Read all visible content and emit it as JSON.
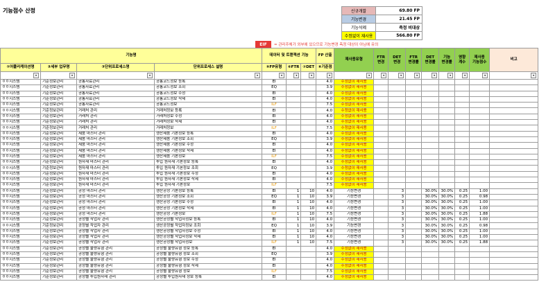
{
  "title": "기능점수 산정",
  "summary": [
    {
      "label": "신규개발",
      "value": "69.80 FP",
      "bg": "#e6b8b7"
    },
    {
      "label": "기능변경",
      "value": "21.45 FP",
      "bg": "#b8cce4"
    },
    {
      "label": "기능삭제",
      "value": "측정 비대상",
      "bg": "#ffffff"
    },
    {
      "label": "수정없이 재사용",
      "value": "566.80 FP",
      "bg": "#ffff00"
    }
  ],
  "eif": {
    "badge": "EIF",
    "note": "= 관리주체가 외부에 있으므로 기능변경 측정 대상이 아님에 유의"
  },
  "headers": {
    "group_function": "기능명",
    "group_data": "데이터 및 트랜잭션 기능",
    "group_fp": "FP 산출",
    "reuse_type": "재사용유형",
    "ftr_change": "FTR\n변경",
    "det_change": "DET\n변경",
    "ftr_rate": "FTR\n변경률",
    "det_rate": "DET\n변경률",
    "func_rate": "기능\n변경률",
    "impact": "영향\n계수",
    "reuse_fp": "재사용\n기능점수",
    "remark": "비고",
    "app": "①어플리케이션명",
    "biz": "②세부 업무명",
    "unit": "③단위프로세스명",
    "desc": "단위프로세스 설명",
    "fp_type": "⑤FP유형",
    "ftr": "⑥FTR",
    "det": "⑦DET",
    "base": "⑧기준점"
  },
  "rows": [
    [
      "ㅇㅇ시스템",
      "기준정보관리",
      "공통자료관리",
      "공통코드정보 등록",
      "EI",
      "",
      "",
      "4.0",
      "수정없이 재사용",
      "",
      "",
      "",
      "",
      "",
      "",
      "",
      ""
    ],
    [
      "ㅇㅇ시스템",
      "기준정보관리",
      "공통자료관리",
      "공통코드정보 조회",
      "EQ",
      "",
      "",
      "3.9",
      "수정없이 재사용",
      "",
      "",
      "",
      "",
      "",
      "",
      "",
      ""
    ],
    [
      "ㅇㅇ시스템",
      "기준정보관리",
      "공통자료관리",
      "공통코드정보 수정",
      "EI",
      "",
      "",
      "4.0",
      "수정없이 재사용",
      "",
      "",
      "",
      "",
      "",
      "",
      "",
      ""
    ],
    [
      "ㅇㅇ시스템",
      "기준정보관리",
      "공통자료관리",
      "공통코드정보 삭제",
      "EI",
      "",
      "",
      "4.0",
      "수정없이 재사용",
      "",
      "",
      "",
      "",
      "",
      "",
      "",
      ""
    ],
    [
      "ㅇㅇ시스템",
      "기준정보관리",
      "공통자료관리",
      "공통코드정보",
      "ILF",
      "",
      "",
      "7.5",
      "수정없이 재사용",
      "",
      "",
      "",
      "",
      "",
      "",
      "",
      ""
    ],
    [
      "ㅇㅇ시스템",
      "기준정보관리",
      "거래처 관리",
      "거래처정보 등록",
      "EI",
      "",
      "",
      "4.0",
      "수정없이 재사용",
      "",
      "",
      "",
      "",
      "",
      "",
      "",
      ""
    ],
    [
      "ㅇㅇ시스템",
      "기준정보관리",
      "거래처 관리",
      "거래처정보 수정",
      "EI",
      "",
      "",
      "4.0",
      "수정없이 재사용",
      "",
      "",
      "",
      "",
      "",
      "",
      "",
      ""
    ],
    [
      "ㅇㅇ시스템",
      "기준정보관리",
      "거래처 관리",
      "거래처정보 삭제",
      "EI",
      "",
      "",
      "4.0",
      "수정없이 재사용",
      "",
      "",
      "",
      "",
      "",
      "",
      "",
      ""
    ],
    [
      "ㅇㅇ시스템",
      "기준정보관리",
      "거래처 관리",
      "거래처정보",
      "ILF",
      "",
      "",
      "7.5",
      "수정없이 재사용",
      "",
      "",
      "",
      "",
      "",
      "",
      "",
      ""
    ],
    [
      "ㅇㅇ시스템",
      "기준정보관리",
      "제품 마스터 관리",
      "생산제품 기본정보 등록",
      "EI",
      "",
      "",
      "4.0",
      "수정없이 재사용",
      "",
      "",
      "",
      "",
      "",
      "",
      "",
      ""
    ],
    [
      "ㅇㅇ시스템",
      "기준정보관리",
      "제품 마스터 관리",
      "생산제품 기본정보 조회",
      "EQ",
      "",
      "",
      "3.9",
      "수정없이 재사용",
      "",
      "",
      "",
      "",
      "",
      "",
      "",
      ""
    ],
    [
      "ㅇㅇ시스템",
      "기준정보관리",
      "제품 마스터 관리",
      "생산제품 기본정보 수정",
      "EI",
      "",
      "",
      "4.0",
      "수정없이 재사용",
      "",
      "",
      "",
      "",
      "",
      "",
      "",
      ""
    ],
    [
      "ㅇㅇ시스템",
      "기준정보관리",
      "제품 마스터 관리",
      "생산제품 기본정보 삭제",
      "EI",
      "",
      "",
      "4.0",
      "수정없이 재사용",
      "",
      "",
      "",
      "",
      "",
      "",
      "",
      ""
    ],
    [
      "ㅇㅇ시스템",
      "기준정보관리",
      "제품 마스터 관리",
      "생산제품 기본정보",
      "ILF",
      "",
      "",
      "7.5",
      "수정없이 재사용",
      "",
      "",
      "",
      "",
      "",
      "",
      "",
      ""
    ],
    [
      "ㅇㅇ시스템",
      "기준정보관리",
      "원자재 마스터 관리",
      "투입 원자재 기본정보 등록",
      "EI",
      "",
      "",
      "4.0",
      "수정없이 재사용",
      "",
      "",
      "",
      "",
      "",
      "",
      "",
      ""
    ],
    [
      "ㅇㅇ시스템",
      "기준정보관리",
      "원자재 마스터 관리",
      "투입 원자재 기본정보 조회",
      "EQ",
      "",
      "",
      "3.9",
      "수정없이 재사용",
      "",
      "",
      "",
      "",
      "",
      "",
      "",
      ""
    ],
    [
      "ㅇㅇ시스템",
      "기준정보관리",
      "원자재 마스터 관리",
      "투입 원자재 기본정보 수정",
      "EI",
      "",
      "",
      "4.0",
      "수정없이 재사용",
      "",
      "",
      "",
      "",
      "",
      "",
      "",
      ""
    ],
    [
      "ㅇㅇ시스템",
      "기준정보관리",
      "원자재 마스터 관리",
      "투입 원자재 기본정보 삭제",
      "EI",
      "",
      "",
      "4.0",
      "수정없이 재사용",
      "",
      "",
      "",
      "",
      "",
      "",
      "",
      ""
    ],
    [
      "ㅇㅇ시스템",
      "기준정보관리",
      "원자재 마스터 관리",
      "투입 원자재 기본정보",
      "ILF",
      "",
      "",
      "7.5",
      "수정없이 재사용",
      "",
      "",
      "",
      "",
      "",
      "",
      "",
      ""
    ],
    [
      "ㅇㅇ시스템",
      "기준정보관리",
      "공정 마스터 관리",
      "생산공정 기본정보 등록",
      "EI",
      "1",
      "10",
      "4.0",
      "기능변경",
      "",
      "3",
      "",
      "30.0%",
      "30.0%",
      "0.25",
      "1.00",
      ""
    ],
    [
      "ㅇㅇ시스템",
      "기준정보관리",
      "공정 마스터 관리",
      "생산공정 기본정보 조회",
      "EQ",
      "1",
      "10",
      "3.9",
      "기능변경",
      "",
      "3",
      "",
      "30.0%",
      "30.0%",
      "0.25",
      "0.98",
      ""
    ],
    [
      "ㅇㅇ시스템",
      "기준정보관리",
      "공정 마스터 관리",
      "생산공정 기본정보 수정",
      "EI",
      "1",
      "10",
      "4.0",
      "기능변경",
      "",
      "3",
      "",
      "30.0%",
      "30.0%",
      "0.25",
      "1.00",
      ""
    ],
    [
      "ㅇㅇ시스템",
      "기준정보관리",
      "공정 마스터 관리",
      "생산공정 기본정보 삭제",
      "EI",
      "1",
      "10",
      "4.0",
      "기능변경",
      "",
      "3",
      "",
      "30.0%",
      "30.0%",
      "0.25",
      "1.00",
      ""
    ],
    [
      "ㅇㅇ시스템",
      "기준정보관리",
      "공정 마스터 관리",
      "생산공정 기본정보",
      "ILF",
      "1",
      "10",
      "7.5",
      "기능변경",
      "",
      "3",
      "",
      "30.0%",
      "30.0%",
      "0.25",
      "1.88",
      ""
    ],
    [
      "ㅇㅇ시스템",
      "기준정보관리",
      "공정별 작업자 관리",
      "생산공정별 작업자정보 등록",
      "EI",
      "1",
      "10",
      "4.0",
      "기능변경",
      "",
      "3",
      "",
      "30.0%",
      "30.0%",
      "0.25",
      "1.00",
      ""
    ],
    [
      "ㅇㅇ시스템",
      "기준정보관리",
      "공정별 작업자 관리",
      "생산공정별 작업자정보 조회",
      "EQ",
      "1",
      "10",
      "3.9",
      "기능변경",
      "",
      "3",
      "",
      "30.0%",
      "30.0%",
      "0.25",
      "0.98",
      ""
    ],
    [
      "ㅇㅇ시스템",
      "기준정보관리",
      "공정별 작업자 관리",
      "생산공정별 작업자정보 수정",
      "EI",
      "1",
      "10",
      "4.0",
      "기능변경",
      "",
      "3",
      "",
      "30.0%",
      "30.0%",
      "0.25",
      "1.00",
      ""
    ],
    [
      "ㅇㅇ시스템",
      "기준정보관리",
      "공정별 작업자 관리",
      "생산공정별 작업자정보 삭제",
      "EI",
      "1",
      "10",
      "4.0",
      "기능변경",
      "",
      "3",
      "",
      "30.0%",
      "30.0%",
      "0.25",
      "1.00",
      ""
    ],
    [
      "ㅇㅇ시스템",
      "기준정보관리",
      "공정별 작업자 관리",
      "생산공정별 작업자정보",
      "ILF",
      "1",
      "10",
      "7.5",
      "기능변경",
      "",
      "3",
      "",
      "30.0%",
      "30.0%",
      "0.25",
      "1.88",
      ""
    ],
    [
      "ㅇㅇ시스템",
      "기준정보관리",
      "공정별 불량유형 관리",
      "공정별 불량유형 정보 등록",
      "EI",
      "",
      "",
      "4.0",
      "수정없이 재사용",
      "",
      "",
      "",
      "",
      "",
      "",
      "",
      ""
    ],
    [
      "ㅇㅇ시스템",
      "기준정보관리",
      "공정별 불량유형 관리",
      "공정별 불량유형 정보 조회",
      "EQ",
      "",
      "",
      "3.9",
      "수정없이 재사용",
      "",
      "",
      "",
      "",
      "",
      "",
      "",
      ""
    ],
    [
      "ㅇㅇ시스템",
      "기준정보관리",
      "공정별 불량유형 관리",
      "공정별 불량유형 정보 수정",
      "EI",
      "",
      "",
      "4.0",
      "수정없이 재사용",
      "",
      "",
      "",
      "",
      "",
      "",
      "",
      ""
    ],
    [
      "ㅇㅇ시스템",
      "기준정보관리",
      "공정별 불량유형 관리",
      "공정별 불량유형 정보 삭제",
      "EI",
      "",
      "",
      "4.0",
      "수정없이 재사용",
      "",
      "",
      "",
      "",
      "",
      "",
      "",
      ""
    ],
    [
      "ㅇㅇ시스템",
      "기준정보관리",
      "공정별 불량유형 관리",
      "공정별 불량유형 정보",
      "ILF",
      "",
      "",
      "7.5",
      "수정없이 재사용",
      "",
      "",
      "",
      "",
      "",
      "",
      "",
      ""
    ],
    [
      "ㅇㅇ시스템",
      "기준정보관리",
      "공정별 투입원자재 관리",
      "공정별 투입원자재 정보 등록",
      "EI",
      "",
      "",
      "4.0",
      "수정없이 재사용",
      "",
      "",
      "",
      "",
      "",
      "",
      "",
      ""
    ]
  ]
}
